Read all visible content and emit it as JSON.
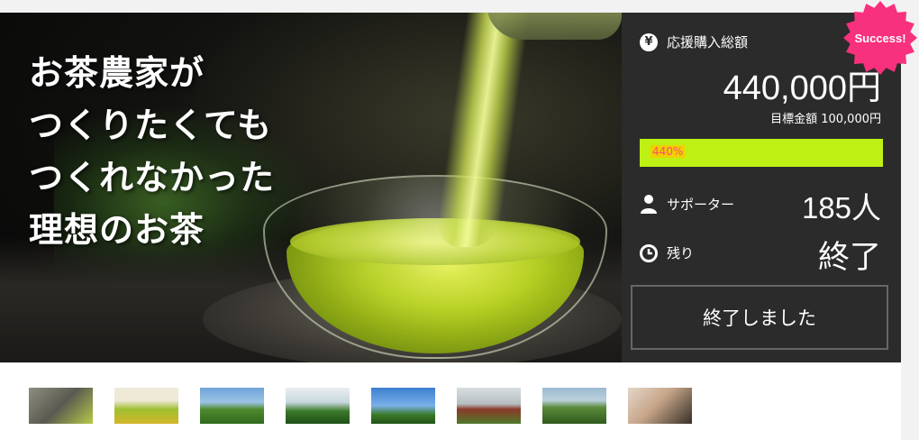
{
  "hero": {
    "headline_lines": [
      "お茶農家が",
      "つくりたくても",
      "つくれなかった",
      "理想のお茶"
    ]
  },
  "badge": {
    "label": "Success!",
    "color": "#f7317e"
  },
  "stats": {
    "total_label": "応援購入総額",
    "total_amount": "440,000円",
    "target_label": "目標金額 100,000円",
    "progress_text": "440%",
    "progress_fraction": 4.4,
    "supporters_label": "サポーター",
    "supporters_value": "185人",
    "remaining_label": "残り",
    "remaining_value": "終了",
    "ended_button": "終了しました",
    "yen_icon": "yen-circle-icon",
    "person_icon": "person-icon",
    "clock_icon": "clock-icon",
    "accent_color": "#bff014"
  },
  "thumbnails": [
    {
      "name": "thumb-1",
      "theme": "tea-poster"
    },
    {
      "name": "thumb-2",
      "theme": "tea-question"
    },
    {
      "name": "thumb-3",
      "theme": "field-landscape"
    },
    {
      "name": "thumb-4",
      "theme": "farmer-field"
    },
    {
      "name": "thumb-5",
      "theme": "farmer-sky"
    },
    {
      "name": "thumb-6",
      "theme": "tea-machine"
    },
    {
      "name": "thumb-7",
      "theme": "group-field"
    },
    {
      "name": "thumb-8",
      "theme": "group-indoor"
    }
  ]
}
